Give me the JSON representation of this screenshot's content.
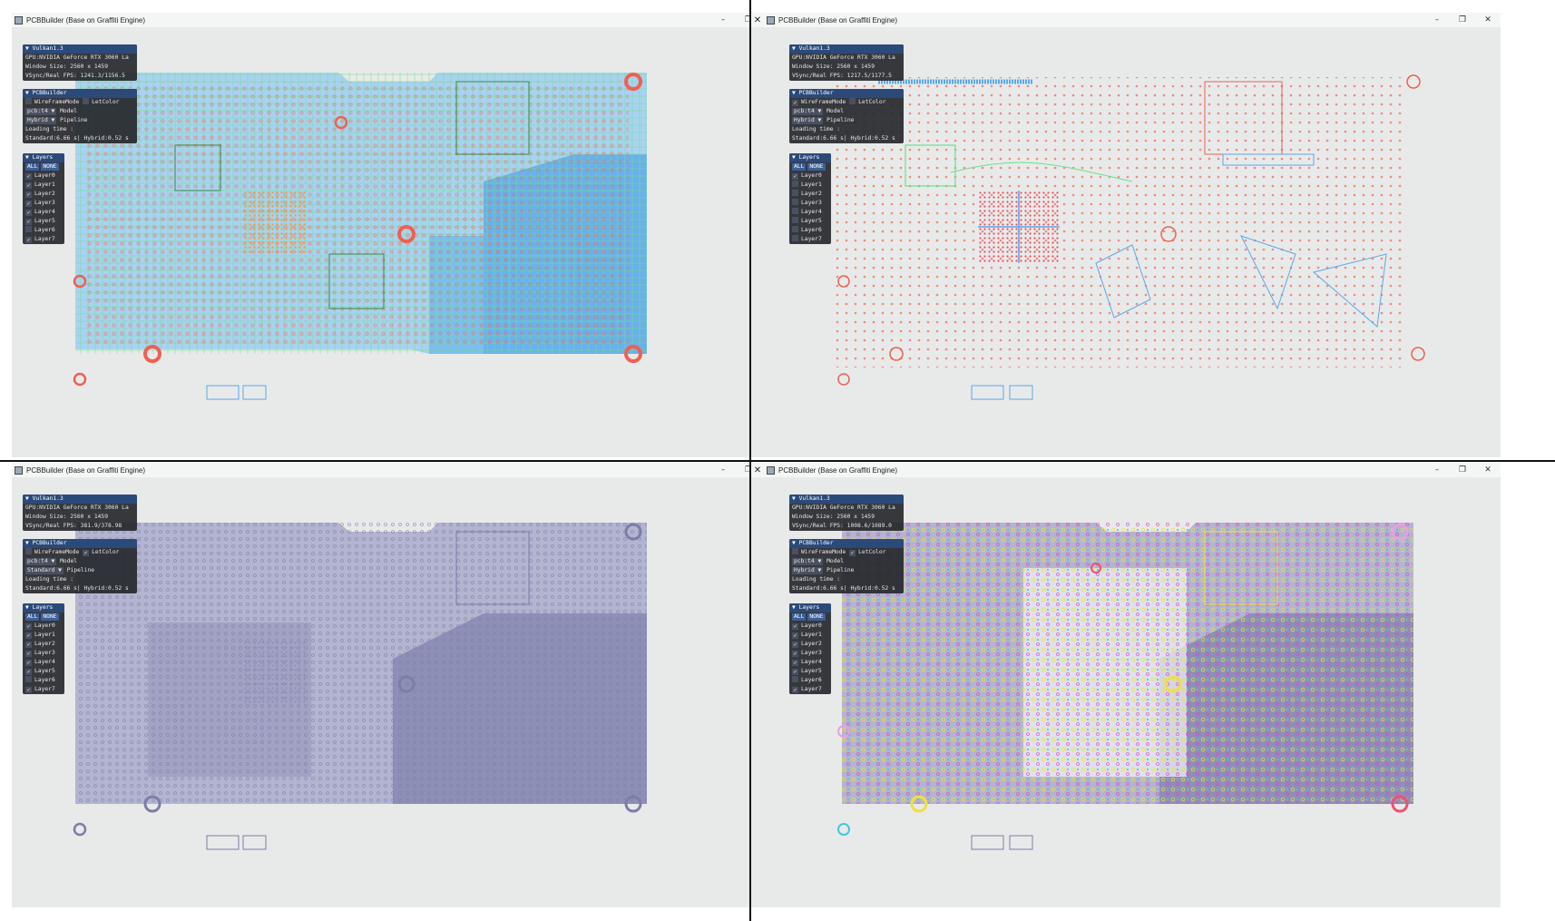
{
  "windows": [
    {
      "title": "PCBBuilder (Base on Graffiti Engine)",
      "stats": {
        "api": "Vulkan1.3",
        "gpu": "GPU:NVIDIA GeForce RTX 3060 La",
        "window_size": "Window Size: 2560 x 1459",
        "fps": "VSync/Real FPS: 1241.3/1156.5"
      },
      "builder": {
        "header": "PCBBuilder",
        "wireframe_label": "WireFrameMode",
        "wireframe_checked": false,
        "letcolor_label": "LetColor",
        "letcolor_checked": false,
        "model_value": "pcb:t4",
        "model_label": "Model",
        "pipeline_value": "Hybrid",
        "pipeline_label": "Pipeline",
        "loading_label": "Loading time :",
        "loading_value": "Standard:6.66 s| Hybrid:0.52 s"
      },
      "layers": {
        "header": "Layers",
        "all_label": "ALL",
        "none_label": "NONE",
        "items": [
          {
            "label": "Layer0",
            "checked": true
          },
          {
            "label": "Layer1",
            "checked": true
          },
          {
            "label": "Layer2",
            "checked": true
          },
          {
            "label": "Layer3",
            "checked": true
          },
          {
            "label": "Layer4",
            "checked": true
          },
          {
            "label": "Layer5",
            "checked": true
          },
          {
            "label": "Layer6",
            "checked": false
          },
          {
            "label": "Layer7",
            "checked": true
          }
        ]
      }
    },
    {
      "title": "PCBBuilder (Base on Graffiti Engine)",
      "stats": {
        "api": "Vulkan1.3",
        "gpu": "GPU:NVIDIA GeForce RTX 3060 La",
        "window_size": "Window Size: 2560 x 1459",
        "fps": "VSync/Real FPS: 1217.5/1177.5"
      },
      "builder": {
        "header": "PCBBuilder",
        "wireframe_label": "WireFrameMode",
        "wireframe_checked": true,
        "letcolor_label": "LetColor",
        "letcolor_checked": false,
        "model_value": "pcb:t4",
        "model_label": "Model",
        "pipeline_value": "Hybrid",
        "pipeline_label": "Pipeline",
        "loading_label": "Loading time :",
        "loading_value": "Standard:6.66 s| Hybrid:0.52 s"
      },
      "layers": {
        "header": "Layers",
        "all_label": "ALL",
        "none_label": "NONE",
        "items": [
          {
            "label": "Layer0",
            "checked": true
          },
          {
            "label": "Layer1",
            "checked": false
          },
          {
            "label": "Layer2",
            "checked": false
          },
          {
            "label": "Layer3",
            "checked": false
          },
          {
            "label": "Layer4",
            "checked": false
          },
          {
            "label": "Layer5",
            "checked": false
          },
          {
            "label": "Layer6",
            "checked": false
          },
          {
            "label": "Layer7",
            "checked": false
          }
        ]
      }
    },
    {
      "title": "PCBBuilder (Base on Graffiti Engine)",
      "stats": {
        "api": "Vulkan1.3",
        "gpu": "GPU:NVIDIA GeForce RTX 3060 La",
        "window_size": "Window Size: 2560 x 1459",
        "fps": "VSync/Real FPS: 381.9/378.98"
      },
      "builder": {
        "header": "PCBBuilder",
        "wireframe_label": "WireFrameMode",
        "wireframe_checked": false,
        "letcolor_label": "LetColor",
        "letcolor_checked": true,
        "model_value": "pcb:t4",
        "model_label": "Model",
        "pipeline_value": "Standard",
        "pipeline_label": "Pipeline",
        "loading_label": "Loading time :",
        "loading_value": "Standard:6.66 s| Hybrid:0.52 s"
      },
      "layers": {
        "header": "Layers",
        "all_label": "ALL",
        "none_label": "NONE",
        "items": [
          {
            "label": "Layer0",
            "checked": true
          },
          {
            "label": "Layer1",
            "checked": true
          },
          {
            "label": "Layer2",
            "checked": true
          },
          {
            "label": "Layer3",
            "checked": true
          },
          {
            "label": "Layer4",
            "checked": true
          },
          {
            "label": "Layer5",
            "checked": true
          },
          {
            "label": "Layer6",
            "checked": false
          },
          {
            "label": "Layer7",
            "checked": true
          }
        ]
      }
    },
    {
      "title": "PCBBuilder (Base on Graffiti Engine)",
      "stats": {
        "api": "Vulkan1.3",
        "gpu": "GPU:NVIDIA GeForce RTX 3060 La",
        "window_size": "Window Size: 2560 x 1459",
        "fps": "VSync/Real FPS: 1008.6/1089.0"
      },
      "builder": {
        "header": "PCBBuilder",
        "wireframe_label": "WireFrameMode",
        "wireframe_checked": false,
        "letcolor_label": "LetColor",
        "letcolor_checked": true,
        "model_value": "pcb:t4",
        "model_label": "Model",
        "pipeline_value": "Hybrid",
        "pipeline_label": "Pipeline",
        "loading_label": "Loading time :",
        "loading_value": "Standard:6.66 s| Hybrid:0.52 s"
      },
      "layers": {
        "header": "Layers",
        "all_label": "ALL",
        "none_label": "NONE",
        "items": [
          {
            "label": "Layer0",
            "checked": true
          },
          {
            "label": "Layer1",
            "checked": true
          },
          {
            "label": "Layer2",
            "checked": true
          },
          {
            "label": "Layer3",
            "checked": true
          },
          {
            "label": "Layer4",
            "checked": true
          },
          {
            "label": "Layer5",
            "checked": true
          },
          {
            "label": "Layer6",
            "checked": false
          },
          {
            "label": "Layer7",
            "checked": true
          }
        ]
      }
    }
  ],
  "colors": {
    "background": "#e8eaea",
    "panel_bg": "#26282c",
    "panel_header": "#2b4a7a",
    "copper_blue": "#8fc4ee",
    "copper_blue_dark": "#5aa8e8",
    "trace_green": "#6ee08a",
    "pad_red": "#f06050",
    "purple_board": "#a9aac8",
    "purple_dark": "#8e8fb6"
  }
}
